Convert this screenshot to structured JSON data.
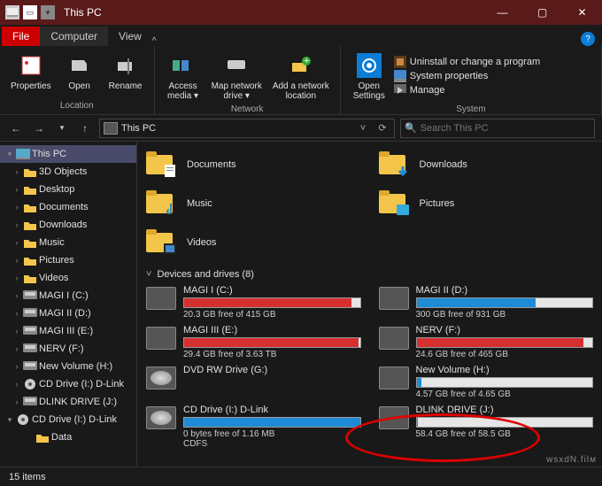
{
  "titlebar": {
    "title": "This PC"
  },
  "tabs": {
    "file": "File",
    "computer": "Computer",
    "view": "View"
  },
  "ribbon": {
    "location": {
      "label": "Location",
      "properties": "Properties",
      "open": "Open",
      "rename": "Rename"
    },
    "network": {
      "label": "Network",
      "access": "Access\nmedia ▾",
      "mapdrive": "Map network\ndrive ▾",
      "addloc": "Add a network\nlocation"
    },
    "system": {
      "label": "System",
      "open_settings": "Open\nSettings",
      "uninstall": "Uninstall or change a program",
      "sysprops": "System properties",
      "manage": "Manage"
    }
  },
  "nav": {
    "path": "This PC",
    "search_placeholder": "Search This PC"
  },
  "tree": [
    {
      "exp": "▾",
      "icon": "pc",
      "label": "This PC",
      "sel": true,
      "indent": 0
    },
    {
      "exp": "›",
      "icon": "3d",
      "label": "3D Objects",
      "indent": 1
    },
    {
      "exp": "›",
      "icon": "desk",
      "label": "Desktop",
      "indent": 1
    },
    {
      "exp": "›",
      "icon": "doc",
      "label": "Documents",
      "indent": 1
    },
    {
      "exp": "›",
      "icon": "dl",
      "label": "Downloads",
      "indent": 1
    },
    {
      "exp": "›",
      "icon": "mus",
      "label": "Music",
      "indent": 1
    },
    {
      "exp": "›",
      "icon": "pic",
      "label": "Pictures",
      "indent": 1
    },
    {
      "exp": "›",
      "icon": "vid",
      "label": "Videos",
      "indent": 1
    },
    {
      "exp": "›",
      "icon": "hd",
      "label": "MAGI I (C:)",
      "indent": 1
    },
    {
      "exp": "›",
      "icon": "hd",
      "label": "MAGI II (D:)",
      "indent": 1
    },
    {
      "exp": "›",
      "icon": "hd",
      "label": "MAGI III (E:)",
      "indent": 1
    },
    {
      "exp": "›",
      "icon": "hd",
      "label": "NERV (F:)",
      "indent": 1
    },
    {
      "exp": "›",
      "icon": "hd",
      "label": "New Volume (H:)",
      "indent": 1
    },
    {
      "exp": "›",
      "icon": "disc",
      "label": "CD Drive (I:) D-Link",
      "indent": 1
    },
    {
      "exp": "›",
      "icon": "hd",
      "label": "DLINK DRIVE (J:)",
      "indent": 1
    },
    {
      "exp": "▾",
      "icon": "disc",
      "label": "CD Drive (I:) D-Link",
      "indent": 0
    },
    {
      "exp": "",
      "icon": "fold",
      "label": "Data",
      "indent": 2
    }
  ],
  "folders": [
    {
      "label": "Documents",
      "overlay": "doc"
    },
    {
      "label": "Downloads",
      "overlay": "dl"
    },
    {
      "label": "Music",
      "overlay": "mus"
    },
    {
      "label": "Pictures",
      "overlay": "pic"
    },
    {
      "label": "Videos",
      "overlay": "vid"
    }
  ],
  "section": {
    "label": "Devices and drives (8)"
  },
  "drives": [
    {
      "name": "MAGI I (C:)",
      "free": "20.3 GB free of 415 GB",
      "fill": 95,
      "color": "red",
      "icon": "hd"
    },
    {
      "name": "MAGI II (D:)",
      "free": "300 GB free of 931 GB",
      "fill": 68,
      "color": "blue",
      "icon": "hd"
    },
    {
      "name": "MAGI III (E:)",
      "free": "29.4 GB free of 3.63 TB",
      "fill": 99,
      "color": "red",
      "icon": "hd"
    },
    {
      "name": "NERV (F:)",
      "free": "24.6 GB free of 465 GB",
      "fill": 95,
      "color": "red",
      "icon": "hd"
    },
    {
      "name": "DVD RW Drive (G:)",
      "free": "",
      "fill": null,
      "icon": "disc"
    },
    {
      "name": "New Volume (H:)",
      "free": "4.57 GB free of 4.65 GB",
      "fill": 3,
      "color": "blue",
      "icon": "hd"
    },
    {
      "name": "CD Drive (I:) D-Link",
      "free": "0 bytes free of 1.16 MB",
      "extra": "CDFS",
      "fill": 100,
      "color": "blue",
      "icon": "disc"
    },
    {
      "name": "DLINK DRIVE (J:)",
      "free": "58.4 GB free of 58.5 GB",
      "fill": 1,
      "color": "blue",
      "icon": "hd"
    }
  ],
  "status": {
    "items": "15 items"
  },
  "watermark": "wsxdN.filᴍ"
}
